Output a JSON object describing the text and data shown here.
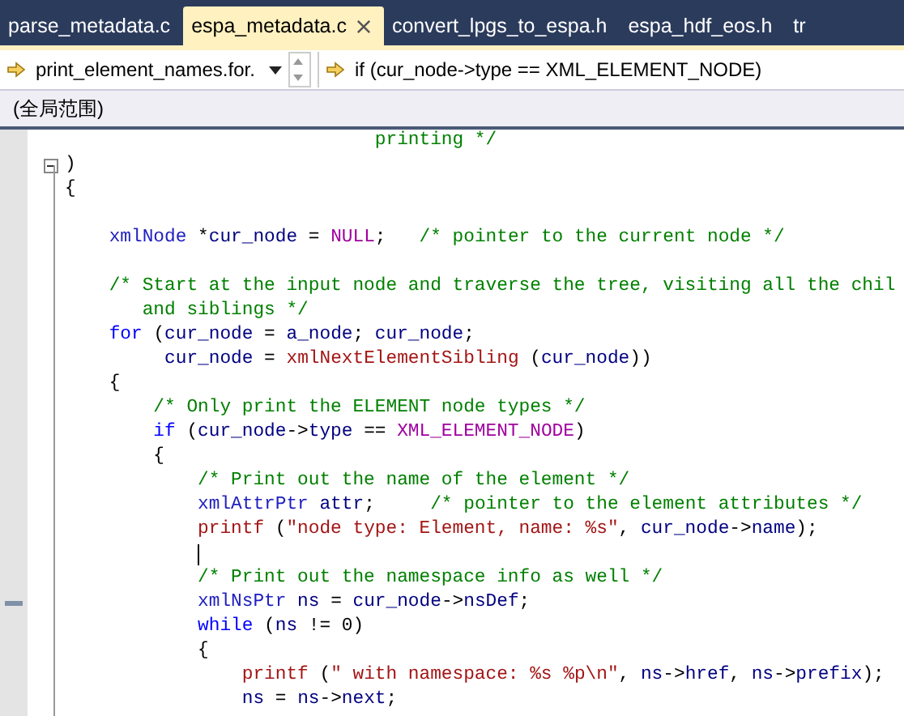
{
  "tabs": [
    {
      "label": "parse_metadata.c",
      "selected": false
    },
    {
      "label": "espa_metadata.c",
      "selected": true
    },
    {
      "label": "convert_lpgs_to_espa.h",
      "selected": false
    },
    {
      "label": "espa_hdf_eos.h",
      "selected": false
    },
    {
      "label": "tr",
      "selected": false
    }
  ],
  "navigation": {
    "function_dropdown": "print_element_names.for.",
    "member_dropdown": "if (cur_node->type == XML_ELEMENT_NODE)"
  },
  "scope": "(全局范围)",
  "code_lines": [
    {
      "kind": "code",
      "tokens": [
        {
          "kind": "comment",
          "text": "                            printing */"
        }
      ]
    },
    {
      "kind": "code",
      "fold": true,
      "tokens": [
        {
          "kind": "plain",
          "text": ")"
        }
      ]
    },
    {
      "kind": "code",
      "tokens": [
        {
          "kind": "plain",
          "text": "{"
        }
      ]
    },
    {
      "kind": "blank"
    },
    {
      "kind": "code",
      "tokens": [
        {
          "kind": "type",
          "text": "    xmlNode"
        },
        {
          "kind": "plain",
          "text": " *"
        },
        {
          "kind": "var",
          "text": "cur_node"
        },
        {
          "kind": "plain",
          "text": " = "
        },
        {
          "kind": "macro",
          "text": "NULL"
        },
        {
          "kind": "plain",
          "text": ";"
        },
        {
          "kind": "comment",
          "text": "   /* pointer to the current node */"
        }
      ]
    },
    {
      "kind": "blank"
    },
    {
      "kind": "code",
      "tokens": [
        {
          "kind": "comment",
          "text": "    /* Start at the input node and traverse the tree, visiting all the chil"
        }
      ]
    },
    {
      "kind": "code",
      "tokens": [
        {
          "kind": "comment",
          "text": "       and siblings */"
        }
      ]
    },
    {
      "kind": "code",
      "tokens": [
        {
          "kind": "kw",
          "text": "    for"
        },
        {
          "kind": "plain",
          "text": " ("
        },
        {
          "kind": "var",
          "text": "cur_node"
        },
        {
          "kind": "plain",
          "text": " = "
        },
        {
          "kind": "var",
          "text": "a_node"
        },
        {
          "kind": "plain",
          "text": "; "
        },
        {
          "kind": "var",
          "text": "cur_node"
        },
        {
          "kind": "plain",
          "text": ";"
        }
      ]
    },
    {
      "kind": "code",
      "tokens": [
        {
          "kind": "var",
          "text": "         cur_node"
        },
        {
          "kind": "plain",
          "text": " = "
        },
        {
          "kind": "func",
          "text": "xmlNextElementSibling"
        },
        {
          "kind": "plain",
          "text": " ("
        },
        {
          "kind": "var",
          "text": "cur_node"
        },
        {
          "kind": "plain",
          "text": "))"
        }
      ]
    },
    {
      "kind": "code",
      "tokens": [
        {
          "kind": "plain",
          "text": "    {"
        }
      ]
    },
    {
      "kind": "code",
      "tokens": [
        {
          "kind": "comment",
          "text": "        /* Only print the ELEMENT node types */"
        }
      ]
    },
    {
      "kind": "code",
      "tokens": [
        {
          "kind": "kw",
          "text": "        if"
        },
        {
          "kind": "plain",
          "text": " ("
        },
        {
          "kind": "var",
          "text": "cur_node"
        },
        {
          "kind": "plain",
          "text": "->"
        },
        {
          "kind": "var",
          "text": "type"
        },
        {
          "kind": "plain",
          "text": " == "
        },
        {
          "kind": "macro",
          "text": "XML_ELEMENT_NODE"
        },
        {
          "kind": "plain",
          "text": ")"
        }
      ]
    },
    {
      "kind": "code",
      "tokens": [
        {
          "kind": "plain",
          "text": "        {"
        }
      ]
    },
    {
      "kind": "code",
      "tokens": [
        {
          "kind": "comment",
          "text": "            /* Print out the name of the element */"
        }
      ]
    },
    {
      "kind": "code",
      "tokens": [
        {
          "kind": "type",
          "text": "            xmlAttrPtr"
        },
        {
          "kind": "var",
          "text": " attr"
        },
        {
          "kind": "plain",
          "text": ";"
        },
        {
          "kind": "comment",
          "text": "     /* pointer to the element attributes */"
        }
      ]
    },
    {
      "kind": "code",
      "tokens": [
        {
          "kind": "func",
          "text": "            printf"
        },
        {
          "kind": "plain",
          "text": " ("
        },
        {
          "kind": "string",
          "text": "\"node type: Element, name: %s\""
        },
        {
          "kind": "plain",
          "text": ", "
        },
        {
          "kind": "var",
          "text": "cur_node"
        },
        {
          "kind": "plain",
          "text": "->"
        },
        {
          "kind": "var",
          "text": "name"
        },
        {
          "kind": "plain",
          "text": ");"
        }
      ]
    },
    {
      "kind": "blank",
      "caret": true
    },
    {
      "kind": "code",
      "tokens": [
        {
          "kind": "comment",
          "text": "            /* Print out the namespace info as well */"
        }
      ]
    },
    {
      "kind": "code",
      "marker": true,
      "tokens": [
        {
          "kind": "type",
          "text": "            xmlNsPtr"
        },
        {
          "kind": "var",
          "text": " ns"
        },
        {
          "kind": "plain",
          "text": " = "
        },
        {
          "kind": "var",
          "text": "cur_node"
        },
        {
          "kind": "plain",
          "text": "->"
        },
        {
          "kind": "var",
          "text": "nsDef"
        },
        {
          "kind": "plain",
          "text": ";"
        }
      ]
    },
    {
      "kind": "code",
      "tokens": [
        {
          "kind": "kw",
          "text": "            while"
        },
        {
          "kind": "plain",
          "text": " ("
        },
        {
          "kind": "var",
          "text": "ns"
        },
        {
          "kind": "plain",
          "text": " != 0)"
        }
      ]
    },
    {
      "kind": "code",
      "tokens": [
        {
          "kind": "plain",
          "text": "            {"
        }
      ]
    },
    {
      "kind": "code",
      "tokens": [
        {
          "kind": "func",
          "text": "                printf"
        },
        {
          "kind": "plain",
          "text": " ("
        },
        {
          "kind": "string",
          "text": "\" with namespace: %s %p\\n\""
        },
        {
          "kind": "plain",
          "text": ", "
        },
        {
          "kind": "var",
          "text": "ns"
        },
        {
          "kind": "plain",
          "text": "->"
        },
        {
          "kind": "var",
          "text": "href"
        },
        {
          "kind": "plain",
          "text": ", "
        },
        {
          "kind": "var",
          "text": "ns"
        },
        {
          "kind": "plain",
          "text": "->"
        },
        {
          "kind": "var",
          "text": "prefix"
        },
        {
          "kind": "plain",
          "text": ");"
        }
      ]
    },
    {
      "kind": "code",
      "tokens": [
        {
          "kind": "var",
          "text": "                ns"
        },
        {
          "kind": "plain",
          "text": " = "
        },
        {
          "kind": "var",
          "text": "ns"
        },
        {
          "kind": "plain",
          "text": "->"
        },
        {
          "kind": "var",
          "text": "next"
        },
        {
          "kind": "plain",
          "text": ";"
        }
      ]
    }
  ]
}
